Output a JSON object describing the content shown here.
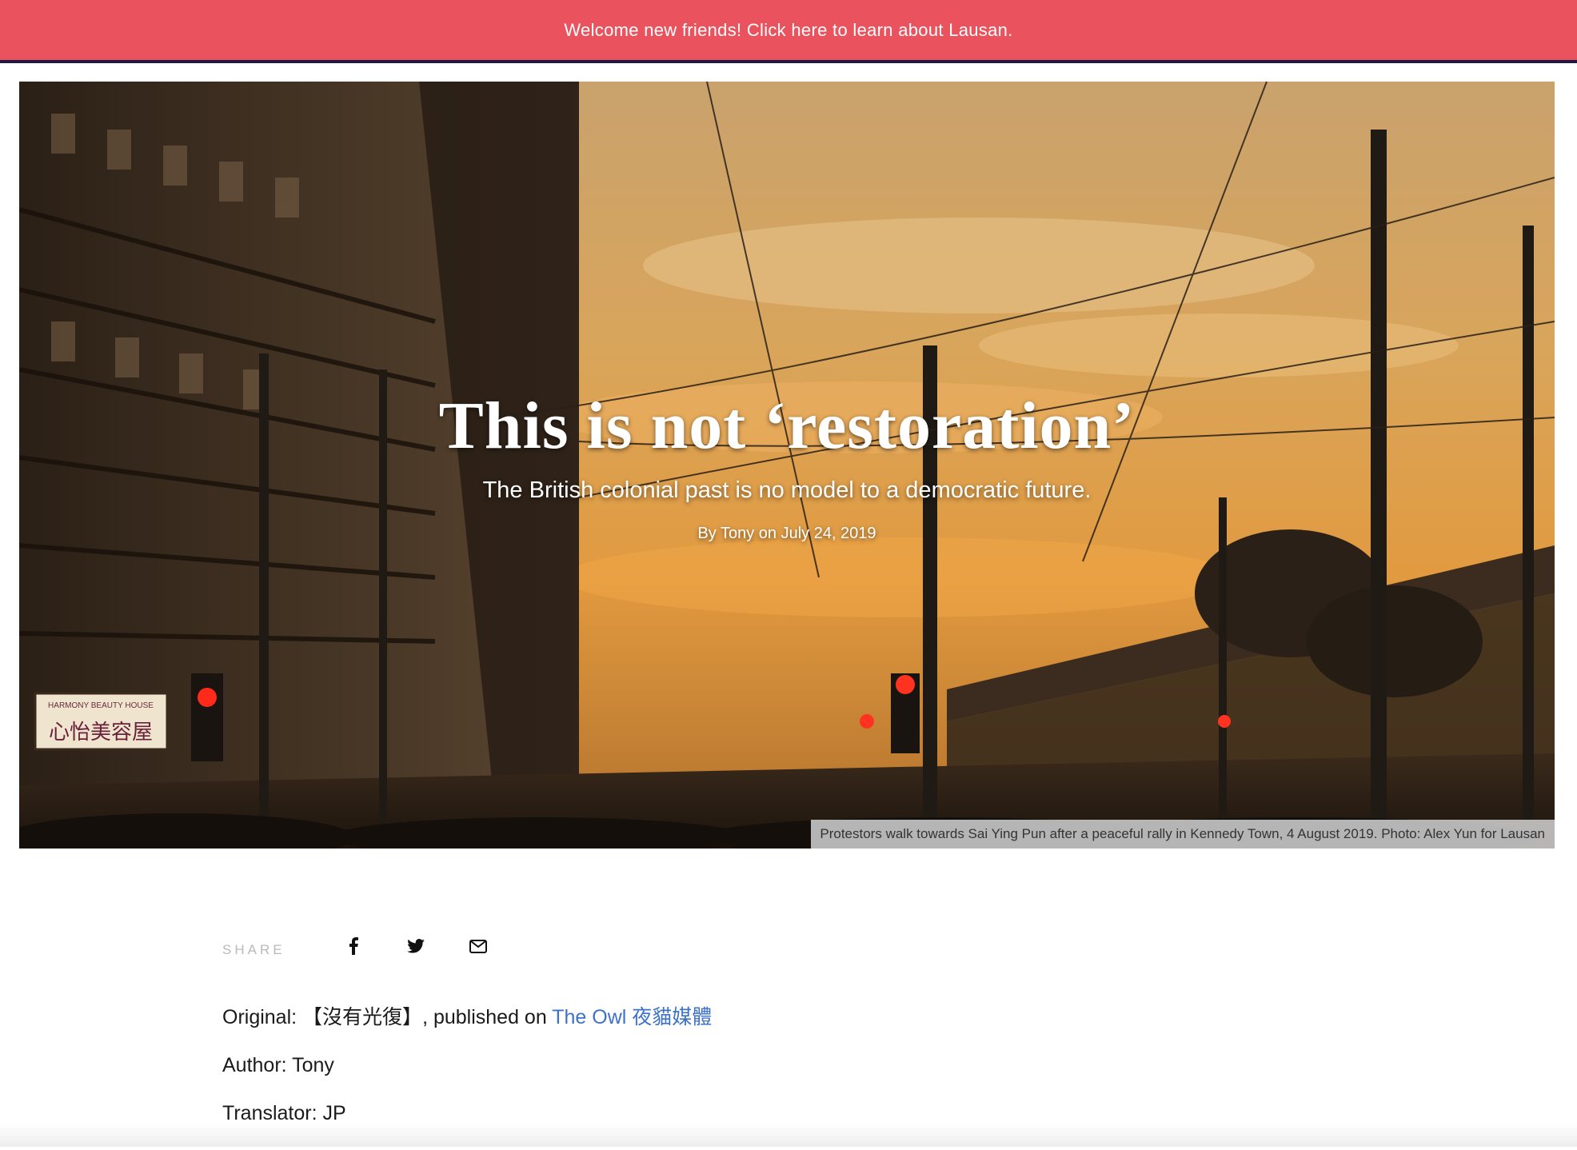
{
  "banner": {
    "text": "Welcome new friends! Click here to learn about Lausan.",
    "background": "#ea535d",
    "border": "#1f1746"
  },
  "hero": {
    "title": "This is not ‘restoration’",
    "subtitle": "The British colonial past is no model to a democratic future.",
    "byline": "By Tony on July 24, 2019",
    "caption": "Protestors walk towards Sai Ying Pun after a peaceful rally in Kennedy Town, 4 August 2019. Photo: Alex Yun for Lausan",
    "signs": {
      "shop_name_en": "HARMONY BEAUTY HOUSE",
      "shop_name_zh": "心怡美容屋"
    }
  },
  "share": {
    "label": "SHARE",
    "icons": [
      "facebook-icon",
      "twitter-icon",
      "email-icon"
    ]
  },
  "article": {
    "original_label": "Original: ",
    "original_title": "【沒有光復】",
    "published_on": ", published on ",
    "source_link": "The Owl 夜貓媒體",
    "author": "Author: Tony",
    "translator": "Translator: JP",
    "link_color": "#3d72c8"
  }
}
